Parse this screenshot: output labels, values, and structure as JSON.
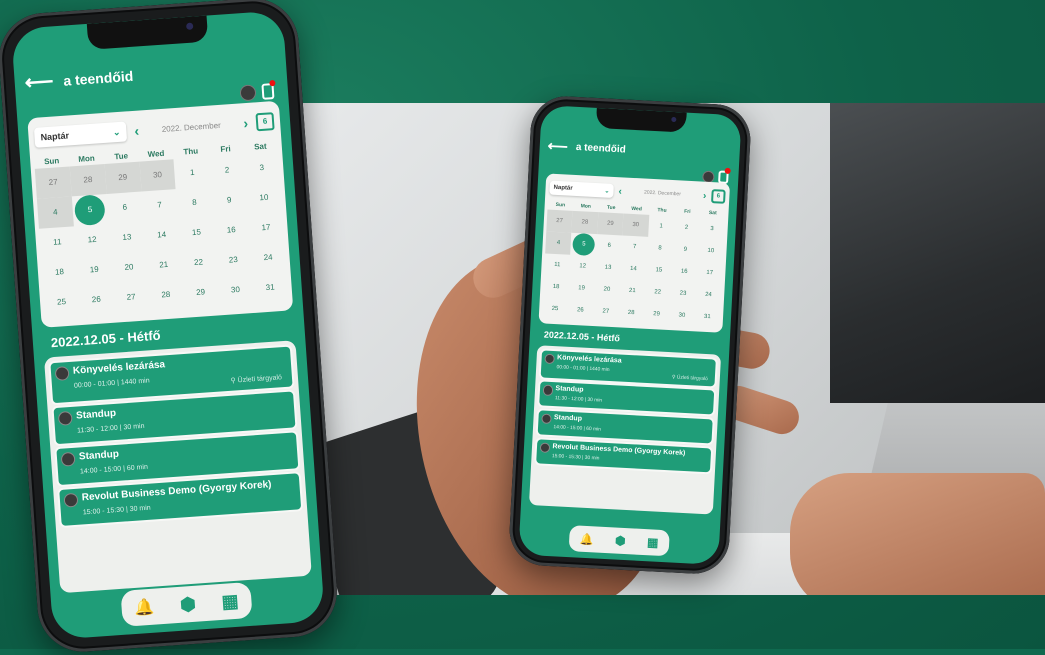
{
  "app": {
    "title": "a teendőid",
    "back_glyph": "⟵",
    "accent": "#1f9d78",
    "background": "#0f6a4f"
  },
  "calendar": {
    "view_select": "Naptár",
    "month": "2022. December",
    "cal_icon_label": "6",
    "days_of_week": [
      "Sun",
      "Mon",
      "Tue",
      "Wed",
      "Thu",
      "Fri",
      "Sat"
    ],
    "weeks": [
      [
        "27",
        "28",
        "29",
        "30",
        "1",
        "2",
        "3"
      ],
      [
        "4",
        "5",
        "6",
        "7",
        "8",
        "9",
        "10"
      ],
      [
        "11",
        "12",
        "13",
        "14",
        "15",
        "16",
        "17"
      ],
      [
        "18",
        "19",
        "20",
        "21",
        "22",
        "23",
        "24"
      ],
      [
        "25",
        "26",
        "27",
        "28",
        "29",
        "30",
        "31"
      ]
    ],
    "selected_day": "5"
  },
  "agenda": {
    "date_title": "2022.12.05 - Hétfő",
    "events": [
      {
        "title": "Könyvelés lezárása",
        "meta": "00:00 - 01:00 | 1440 min",
        "location": "Üzleti tárgyaló"
      },
      {
        "title": "Standup",
        "meta": "11:30 - 12:00 | 30 min"
      },
      {
        "title": "Standup",
        "meta": "14:00 - 15:00 | 60 min"
      },
      {
        "title": "Revolut Business Demo (Gyorgy Korek)",
        "meta": "15:00 - 15:30 | 30 min"
      }
    ]
  },
  "nav": {
    "bell_icon": "🔔",
    "home_icon": "⬢",
    "grid_icon": "▦"
  }
}
